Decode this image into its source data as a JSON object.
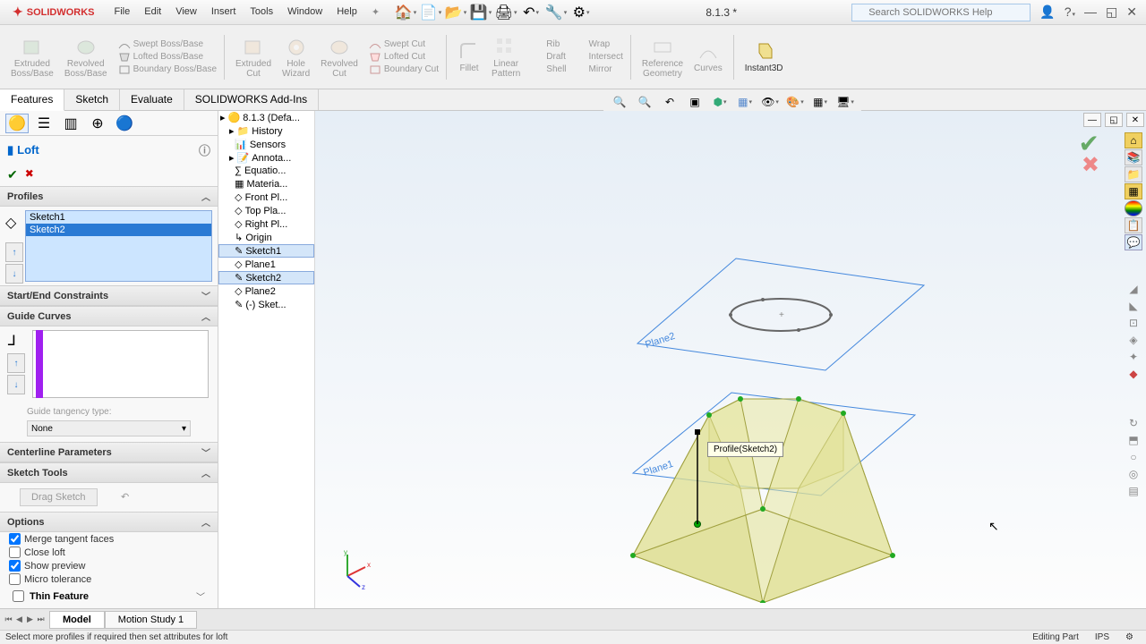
{
  "app": {
    "name": "SOLIDWORKS",
    "doc_title": "8.1.3 *",
    "search_placeholder": "Search SOLIDWORKS Help"
  },
  "menu": [
    "File",
    "Edit",
    "View",
    "Insert",
    "Tools",
    "Window",
    "Help"
  ],
  "ribbon": {
    "extruded": "Extruded\nBoss/Base",
    "revolved": "Revolved\nBoss/Base",
    "swept": "Swept Boss/Base",
    "lofted": "Lofted Boss/Base",
    "boundary": "Boundary Boss/Base",
    "extruded_cut": "Extruded\nCut",
    "hole": "Hole\nWizard",
    "revolved_cut": "Revolved\nCut",
    "swept_cut": "Swept Cut",
    "lofted_cut": "Lofted Cut",
    "boundary_cut": "Boundary Cut",
    "fillet": "Fillet",
    "linear": "Linear\nPattern",
    "rib": "Rib",
    "draft": "Draft",
    "shell": "Shell",
    "wrap": "Wrap",
    "intersect": "Intersect",
    "mirror": "Mirror",
    "refgeo": "Reference\nGeometry",
    "curves": "Curves",
    "instant": "Instant3D"
  },
  "tabs": [
    "Features",
    "Sketch",
    "Evaluate",
    "SOLIDWORKS Add-Ins"
  ],
  "pm": {
    "title": "Loft",
    "sections": {
      "profiles": "Profiles",
      "startend": "Start/End Constraints",
      "guide": "Guide Curves",
      "centerline": "Centerline Parameters",
      "sketchtools": "Sketch Tools",
      "options": "Options"
    },
    "profiles_items": [
      "Sketch1",
      "Sketch2"
    ],
    "guide_tangency": "Guide tangency type:",
    "tangency_value": "None",
    "drag": "Drag Sketch",
    "opts": {
      "merge": "Merge tangent faces",
      "close": "Close loft",
      "preview": "Show preview",
      "micro": "Micro tolerance"
    },
    "thin": "Thin Feature"
  },
  "tree": {
    "root": "8.1.3  (Defa...",
    "items": [
      "History",
      "Sensors",
      "Annota...",
      "Equatio...",
      "Materia...",
      "Front Pl...",
      "Top Pla...",
      "Right Pl...",
      "Origin",
      "Sketch1",
      "Plane1",
      "Sketch2",
      "Plane2",
      "(-) Sket..."
    ]
  },
  "viewport": {
    "plane1": "Plane1",
    "plane2": "Plane2",
    "callout": "Profile(Sketch2)"
  },
  "bottom_tabs": [
    "Model",
    "Motion Study 1"
  ],
  "status": {
    "msg": "Select more profiles if required then set attributes for loft",
    "mode": "Editing Part",
    "ips": "IPS"
  }
}
